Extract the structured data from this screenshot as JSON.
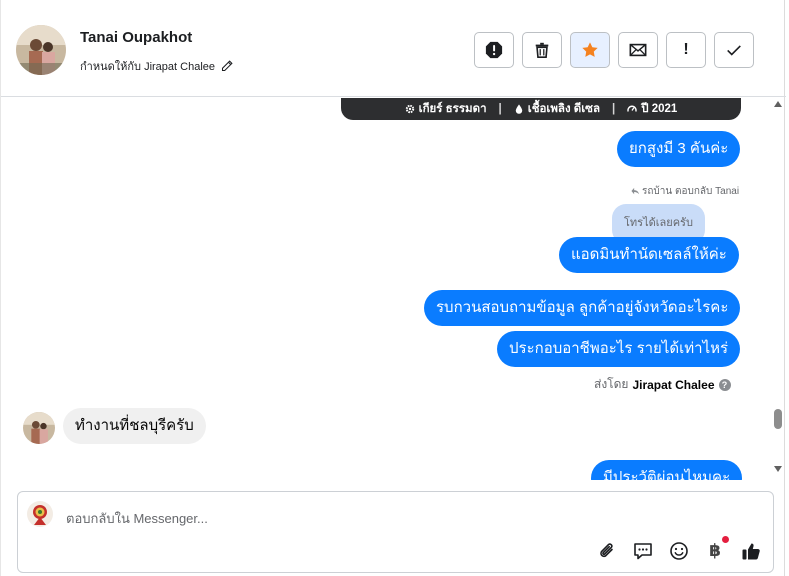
{
  "header": {
    "contact_name": "Tanai Oupakhot",
    "assigned_label": "กำหนดให้กับ Jirapat Chalee",
    "actions": [
      {
        "icon": "exclamation-circle-icon"
      },
      {
        "icon": "trash-icon"
      },
      {
        "icon": "star-icon",
        "color": "#f5821f"
      },
      {
        "icon": "envelope-icon"
      },
      {
        "icon": "exclamation-icon",
        "text": "!"
      },
      {
        "icon": "check-icon"
      }
    ]
  },
  "car_info": {
    "gear": "เกียร์ ธรรมดา",
    "fuel": "เชื้อเพลิง ดีเซล",
    "year": "ปี 2021",
    "separator": "|"
  },
  "messages": {
    "m1": "ยกสูงมี 3 คันค่ะ",
    "reply_label": "รถบ้าน ตอบกลับ Tanai",
    "quoted": "โทรได้เลยครับ",
    "m2": "แอดมินทำนัดเซลล์ให้ค่ะ",
    "m3": "รบกวนสอบถามข้อมูล ลูกค้าอยู่จังหวัดอะไรคะ",
    "m4": "ประกอบอาชีพอะไร รายได้เท่าไหร่",
    "sent_by_prefix": "ส่งโดย",
    "sent_by_name": "Jirapat Chalee",
    "help": "?",
    "incoming": "ทำงานที่ชลบุรีครับ",
    "m5_partial": "มีประวัติผ่อนไหมคะ"
  },
  "composer": {
    "placeholder": "ตอบกลับใน Messenger...",
    "tools": [
      "paperclip-icon",
      "comment-icon",
      "smile-icon",
      "baht-icon",
      "thumbs-up-icon"
    ],
    "baht_symbol": "฿"
  },
  "colors": {
    "bubble_out": "#0a7cff",
    "bubble_in": "#f0f0f0",
    "info_bar": "#2d2e30",
    "star": "#f5821f",
    "notification_dot": "#e41e3f"
  }
}
